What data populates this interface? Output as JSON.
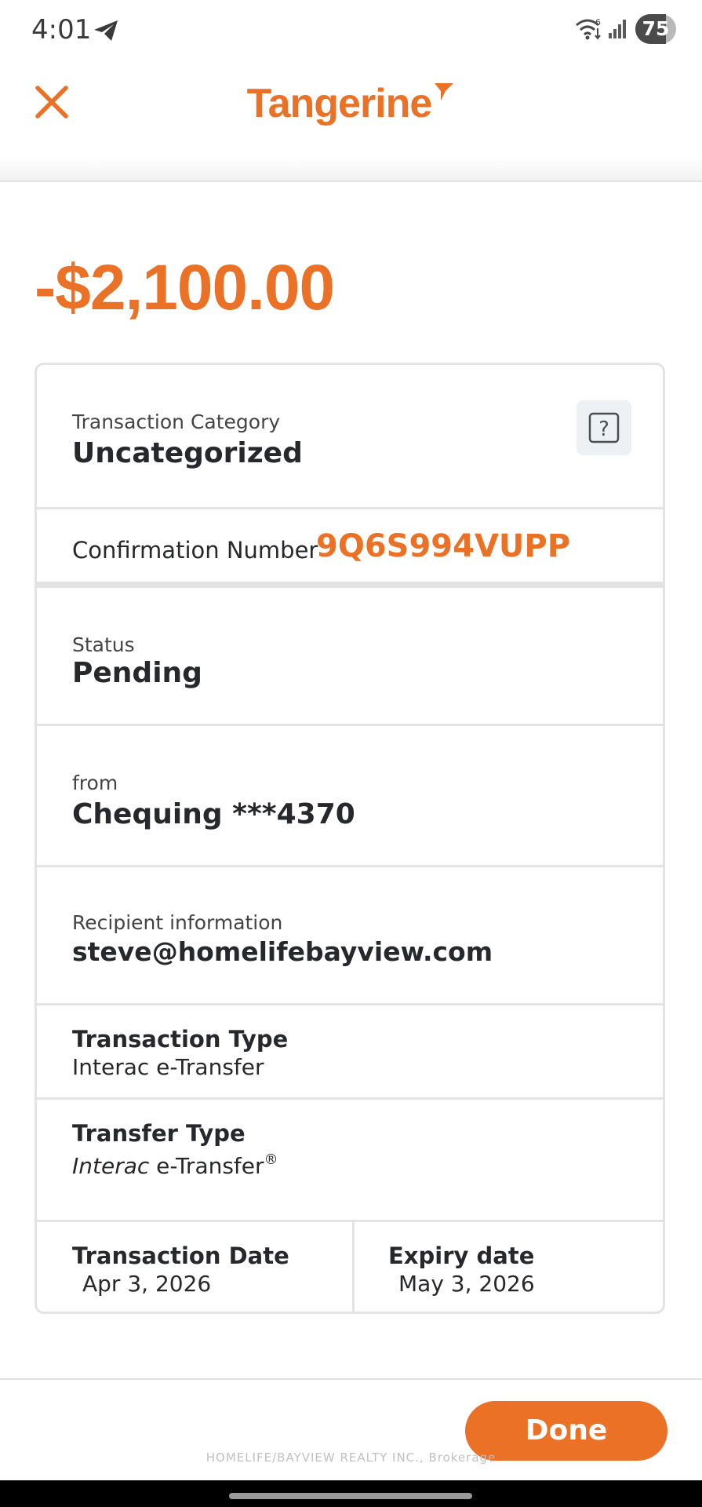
{
  "status_bar": {
    "time": "4:01",
    "battery_level": "75",
    "battery_fraction": 0.75
  },
  "header": {
    "logo_text": "Tangerine"
  },
  "transaction": {
    "amount": "-$2,100.00",
    "category_label": "Transaction Category",
    "category_value": "Uncategorized",
    "help_glyph": "?",
    "confirmation_label": "Confirmation Number",
    "confirmation_number": "9Q6S994VUPP",
    "status_label": "Status",
    "status_value": "Pending",
    "from_label": "from",
    "from_value": "Chequing ***4370",
    "recipient_label": "Recipient information",
    "recipient_value": "steve@homelifebayview.com",
    "transaction_type_label": "Transaction Type",
    "transaction_type_value": "Interac e-Transfer",
    "transfer_type_label": "Transfer Type",
    "transfer_type_italic": "Interac",
    "transfer_type_rest": " e-Transfer",
    "transfer_type_mark": "®",
    "transaction_date_label": "Transaction Date",
    "transaction_date_value": "Apr 3, 2026",
    "expiry_date_label": "Expiry date",
    "expiry_date_value": "May 3, 2026"
  },
  "footer": {
    "done_label": "Done",
    "watermark": "HOMELIFE/BAYVIEW REALTY INC., Brokerage"
  },
  "colors": {
    "brand_orange": "#ea7125",
    "text_dark": "#26282b",
    "border": "#e3e3e3"
  },
  "icons": [
    "telegram-icon",
    "wifi-icon",
    "signal-icon",
    "close-icon",
    "question-icon"
  ]
}
